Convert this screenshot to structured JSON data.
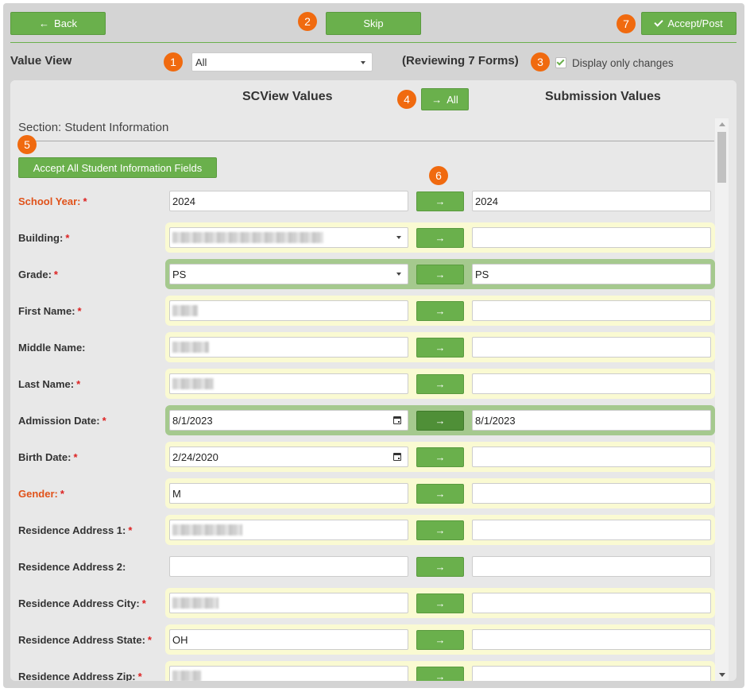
{
  "toolbar": {
    "back_label": "Back",
    "skip_label": "Skip",
    "accept_label": "Accept/Post"
  },
  "badges": [
    "1",
    "2",
    "3",
    "4",
    "5",
    "6",
    "7"
  ],
  "filter": {
    "label": "Value View",
    "selected": "All",
    "reviewing": "(Reviewing 7 Forms)",
    "checkbox_label": "Display only changes",
    "checkbox_checked": true
  },
  "columns": {
    "scview": "SCView Values",
    "submission": "Submission Values",
    "all_label": "All"
  },
  "section": {
    "title": "Section: Student Information",
    "accept_all_label": "Accept All Student Information Fields"
  },
  "fields": [
    {
      "label": "School Year:",
      "required": "*",
      "orange": true,
      "highlight": "none",
      "left": "2024",
      "right": "2024",
      "type": "text"
    },
    {
      "label": "Building:",
      "required": "*",
      "orange": false,
      "highlight": "yellow",
      "left": "",
      "right": "",
      "type": "select",
      "blurred": 190
    },
    {
      "label": "Grade:",
      "required": "*",
      "orange": false,
      "highlight": "green",
      "left": "PS",
      "right": "PS",
      "type": "select"
    },
    {
      "label": "First Name:",
      "required": "*",
      "orange": false,
      "highlight": "yellow",
      "left": "",
      "right": "",
      "type": "text",
      "blurred": 32
    },
    {
      "label": "Middle Name:",
      "required": "",
      "orange": false,
      "highlight": "yellow",
      "left": "",
      "right": "",
      "type": "text",
      "blurred": 46
    },
    {
      "label": "Last Name:",
      "required": "*",
      "orange": false,
      "highlight": "yellow",
      "left": "",
      "right": "",
      "type": "text",
      "blurred": 52
    },
    {
      "label": "Admission Date:",
      "required": "*",
      "orange": false,
      "highlight": "green",
      "left": "8/1/2023",
      "right": "8/1/2023",
      "type": "date",
      "dark_arrow": true
    },
    {
      "label": "Birth Date:",
      "required": "*",
      "orange": false,
      "highlight": "yellow",
      "left": "2/24/2020",
      "right": "",
      "type": "date"
    },
    {
      "label": "Gender:",
      "required": "*",
      "orange": true,
      "highlight": "yellow",
      "left": "M",
      "right": "",
      "type": "text"
    },
    {
      "label": "Residence Address 1:",
      "required": "*",
      "orange": false,
      "highlight": "yellow",
      "left": "",
      "right": "",
      "type": "text",
      "blurred": 88
    },
    {
      "label": "Residence Address 2:",
      "required": "",
      "orange": false,
      "highlight": "none",
      "left": "",
      "right": "",
      "type": "text"
    },
    {
      "label": "Residence Address City:",
      "required": "*",
      "orange": false,
      "highlight": "yellow",
      "left": "",
      "right": "",
      "type": "text",
      "blurred": 58
    },
    {
      "label": "Residence Address State:",
      "required": "*",
      "orange": false,
      "highlight": "yellow",
      "left": "OH",
      "right": "",
      "type": "text"
    },
    {
      "label": "Residence Address Zip:",
      "required": "*",
      "orange": false,
      "highlight": "yellow",
      "left": "",
      "right": "",
      "type": "text",
      "blurred": 36
    }
  ]
}
